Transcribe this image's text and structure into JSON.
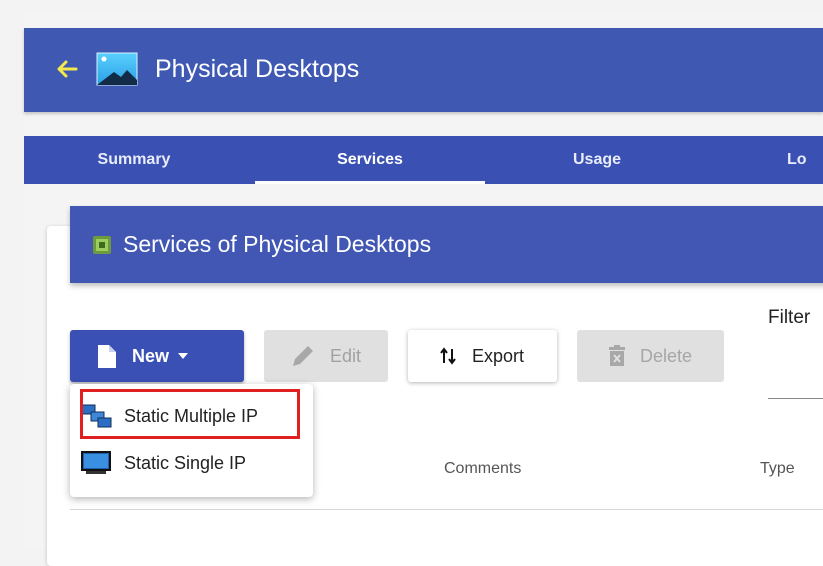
{
  "header": {
    "title": "Physical Desktops",
    "back_icon": "back-arrow-icon",
    "app_icon": "desktop-landscape-icon"
  },
  "tabs": [
    {
      "label": "Summary",
      "active": false
    },
    {
      "label": "Services",
      "active": true
    },
    {
      "label": "Usage",
      "active": false
    },
    {
      "label": "Lo",
      "active": false
    }
  ],
  "card": {
    "title": "Services of Physical Desktops",
    "icon": "chip-icon"
  },
  "toolbar": {
    "new_label": "New",
    "edit_label": "Edit",
    "export_label": "Export",
    "delete_label": "Delete"
  },
  "dropdown": {
    "items": [
      {
        "label": "Static Multiple IP",
        "icon": "network-multiple-icon",
        "highlighted": true
      },
      {
        "label": "Static Single IP",
        "icon": "monitor-icon",
        "highlighted": false
      }
    ]
  },
  "filter": {
    "label": "Filter"
  },
  "table": {
    "columns": [
      "Comments",
      "Type"
    ]
  },
  "colors": {
    "header": "#3f59b3",
    "tab_bar": "#3a50b3",
    "primary_button": "#3b50b4",
    "highlight_border": "#e02020"
  }
}
